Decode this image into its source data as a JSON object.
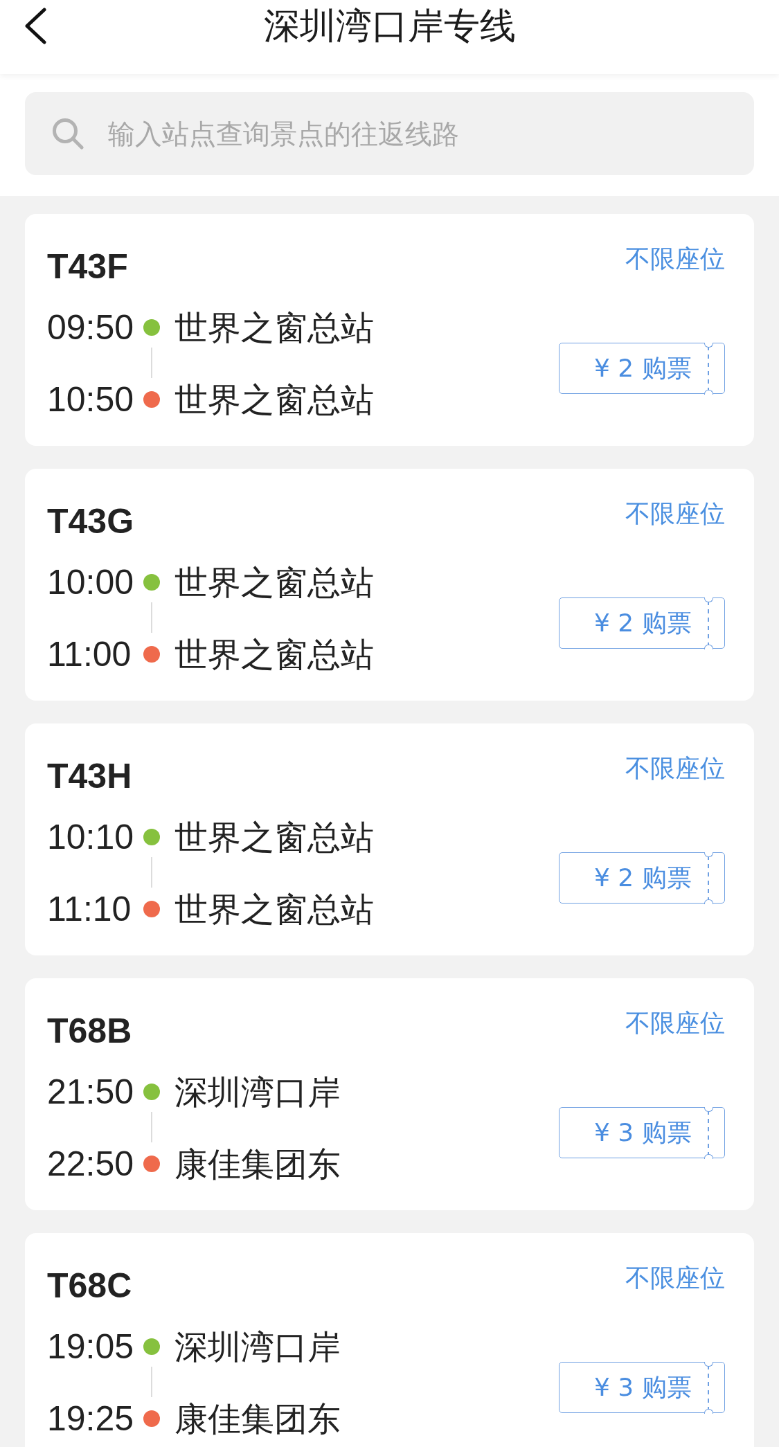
{
  "header": {
    "title": "深圳湾口岸专线"
  },
  "search": {
    "placeholder": "输入站点查询景点的往返线路"
  },
  "routes": [
    {
      "name": "T43F",
      "seat_note": "不限座位",
      "stops": [
        {
          "time": "09:50",
          "station": "世界之窗总站",
          "color": "#86c13e"
        },
        {
          "time": "10:50",
          "station": "世界之窗总站",
          "color": "#ef6a4c"
        }
      ],
      "buy_button": "¥ 2 购票"
    },
    {
      "name": "T43G",
      "seat_note": "不限座位",
      "stops": [
        {
          "time": "10:00",
          "station": "世界之窗总站",
          "color": "#86c13e"
        },
        {
          "time": "11:00",
          "station": "世界之窗总站",
          "color": "#ef6a4c"
        }
      ],
      "buy_button": "¥ 2 购票"
    },
    {
      "name": "T43H",
      "seat_note": "不限座位",
      "stops": [
        {
          "time": "10:10",
          "station": "世界之窗总站",
          "color": "#86c13e"
        },
        {
          "time": "11:10",
          "station": "世界之窗总站",
          "color": "#ef6a4c"
        }
      ],
      "buy_button": "¥ 2 购票"
    },
    {
      "name": "T68B",
      "seat_note": "不限座位",
      "stops": [
        {
          "time": "21:50",
          "station": "深圳湾口岸",
          "color": "#86c13e"
        },
        {
          "time": "22:50",
          "station": "康佳集团东",
          "color": "#ef6a4c"
        }
      ],
      "buy_button": "¥ 3 购票"
    },
    {
      "name": "T68C",
      "seat_note": "不限座位",
      "stops": [
        {
          "time": "19:05",
          "station": "深圳湾口岸",
          "color": "#86c13e"
        },
        {
          "time": "19:25",
          "station": "康佳集团东",
          "color": "#ef6a4c"
        }
      ],
      "buy_button": "¥ 3 购票"
    }
  ]
}
